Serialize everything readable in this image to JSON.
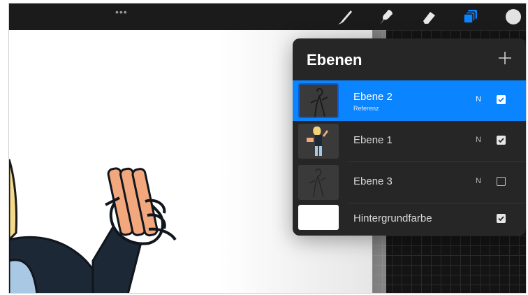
{
  "colors": {
    "accent": "#0a84ff",
    "panel": "#262626",
    "toolbar": "#1b1b1b"
  },
  "toolbar": {
    "menu_dots": "•••",
    "tools": [
      "brush-icon",
      "smudge-icon",
      "eraser-icon",
      "layers-icon",
      "color-swatch"
    ]
  },
  "layers_panel": {
    "title": "Ebenen",
    "add_label": "+",
    "layers": [
      {
        "name": "Ebene 2",
        "subtitle": "Referenz",
        "mode": "N",
        "visible": true,
        "selected": true
      },
      {
        "name": "Ebene 1",
        "subtitle": "",
        "mode": "N",
        "visible": true,
        "selected": false
      },
      {
        "name": "Ebene 3",
        "subtitle": "",
        "mode": "N",
        "visible": false,
        "selected": false
      },
      {
        "name": "Hintergrundfarbe",
        "subtitle": "",
        "mode": "",
        "visible": true,
        "selected": false
      }
    ]
  }
}
